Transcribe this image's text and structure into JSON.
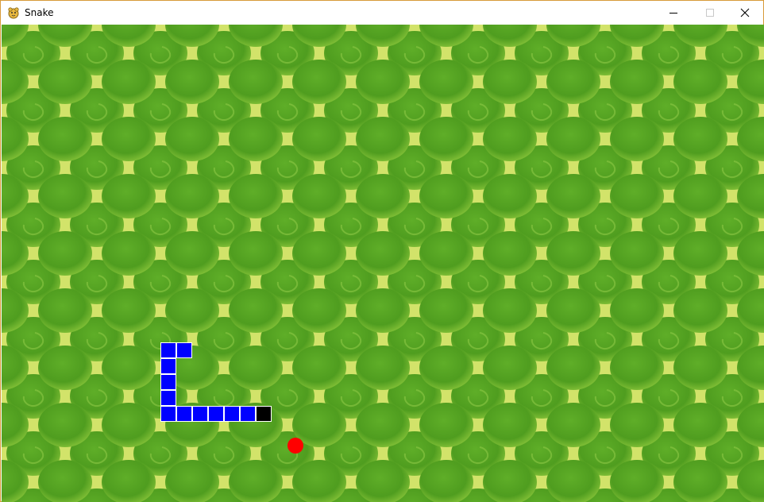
{
  "window": {
    "title": "Snake",
    "icon": "pygame-snake-icon",
    "controls": [
      "minimize-icon",
      "maximize-icon",
      "close-icon"
    ]
  },
  "game": {
    "background": "green-snakeskin-texture",
    "colors": {
      "snake_body": "#0000ff",
      "snake_head": "#000000",
      "segment_border": "#ffffff",
      "food": "#ff0000",
      "skin_base": "#6fb22f",
      "skin_scale": "#5aa825",
      "skin_ridge": "#d6e870"
    },
    "snake": {
      "length": 11,
      "direction": "right"
    },
    "food_count": 1
  }
}
